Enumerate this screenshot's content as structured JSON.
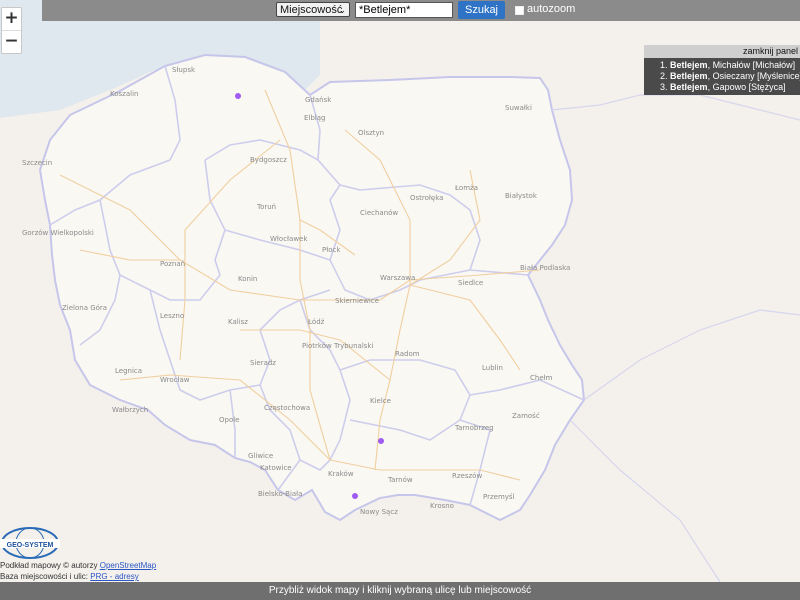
{
  "zoom": {
    "in_label": "+",
    "out_label": "−"
  },
  "search": {
    "type_select": "Miejscowość",
    "query": "*Betlejem*",
    "submit_label": "Szukaj",
    "autozoom_label": "autozoom",
    "autozoom_checked": false
  },
  "results_panel": {
    "close_label": "zamknij panel",
    "items": [
      {
        "num": "1.",
        "name": "Betlejem",
        "detail": ", Michałów [Michałów]"
      },
      {
        "num": "2.",
        "name": "Betlejem",
        "detail": ", Osieczany [Myślenice]"
      },
      {
        "num": "3.",
        "name": "Betlejem",
        "detail": ", Gapowo [Stężyca]"
      }
    ]
  },
  "map": {
    "marker_color": "#a05bf0",
    "border_color": "#b8b8e6",
    "road_color": "#efc48a",
    "place_labels": [
      "Gdańsk",
      "Olsztyn",
      "Koszalin",
      "Słupsk",
      "Białystok",
      "Szczecin",
      "Gorzów Wielkopolski",
      "Poznań",
      "Bydgoszcz",
      "Toruń",
      "Włocławek",
      "Płock",
      "Warszawa",
      "Siedlce",
      "Biała Podlaska",
      "Łódź",
      "Skierniewice",
      "Piotrków Trybunalski",
      "Radom",
      "Lublin",
      "Chełm",
      "Zamość",
      "Zielona Góra",
      "Leszno",
      "Kalisz",
      "Konin",
      "Legnica",
      "Wrocław",
      "Wałbrzych",
      "Opole",
      "Częstochowa",
      "Kielce",
      "Tarnobrzeg",
      "Katowice",
      "Gliwice",
      "Kraków",
      "Tarnów",
      "Rzeszów",
      "Przemyśl",
      "Krosno",
      "Nowy Sącz",
      "Bielsko-Biała",
      "Ostrołęka",
      "Łomża",
      "Suwałki",
      "Elbląg",
      "Sieradz",
      "Ciechanów"
    ]
  },
  "attribution": {
    "line1_prefix": "Podkład mapowy © autorzy ",
    "line1_link": "OpenStreetMap",
    "line2_prefix": "Baza miejscowości i ulic: ",
    "line2_link": "PRG - adresy",
    "logo_text": "GEO-SYSTEM"
  },
  "status_bar": {
    "text": "Przybliż widok mapy i kliknij wybraną ulicę lub miejscowość"
  }
}
